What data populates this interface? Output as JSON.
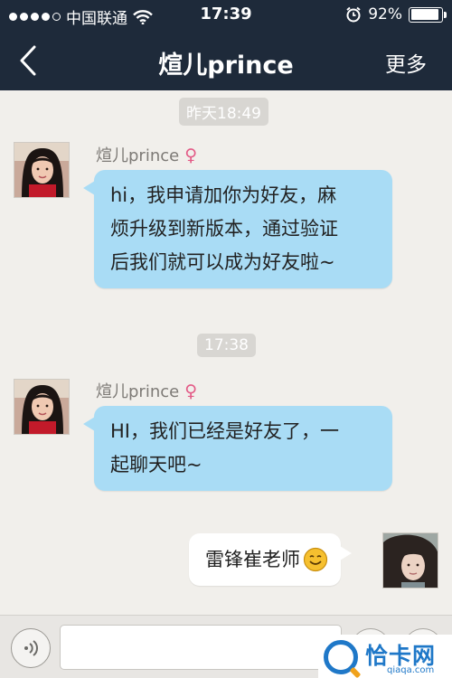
{
  "status_bar": {
    "carrier": "中国联通",
    "time": "17:39",
    "battery_percent": "92%",
    "battery_level": 0.92,
    "icons": [
      "signal-dots-icon",
      "wifi-icon",
      "alarm-clock-icon",
      "battery-icon"
    ]
  },
  "nav": {
    "back_icon": "chevron-left-icon",
    "title": "煊儿prince",
    "more_label": "更多"
  },
  "chat": {
    "timestamps": [
      "昨天18:49",
      "17:38"
    ],
    "messages": [
      {
        "sender": "煊儿prince",
        "gender_icon": "female-icon",
        "gender_symbol": "♀",
        "side": "left",
        "lines": [
          "hi，我申请加你为好友，麻",
          "烦升级到新版本，通过验证",
          "后我们就可以成为好友啦~"
        ]
      },
      {
        "sender": "煊儿prince",
        "gender_icon": "female-icon",
        "gender_symbol": "♀",
        "side": "left",
        "lines": [
          "HI，我们已经是好友了，一",
          "起聊天吧~"
        ]
      },
      {
        "side": "right",
        "text": "雷锋崔老师",
        "emoji_icon": "smiley-face-icon"
      }
    ]
  },
  "input_bar": {
    "voice_icon": "voice-wave-icon",
    "text_value": "",
    "placeholder": ""
  },
  "watermark": {
    "brand": "恰卡网",
    "url": "qiaqa.com"
  },
  "colors": {
    "nav_bg": "#1e2a3a",
    "chat_bg": "#f1efeb",
    "received_bubble": "#a9dcf5",
    "sent_bubble": "#ffffff",
    "female_icon": "#e35a86"
  }
}
